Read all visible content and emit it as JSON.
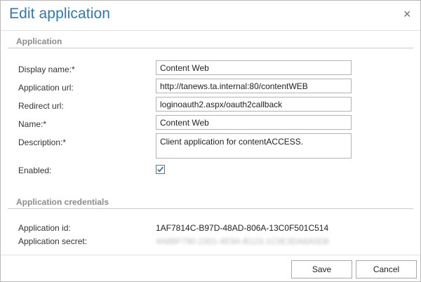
{
  "dialog": {
    "title": "Edit application",
    "close_glyph": "×"
  },
  "application": {
    "header": "Application",
    "fields": {
      "display_name": {
        "label": "Display name:*",
        "value": "Content Web"
      },
      "application_url": {
        "label": "Application url:",
        "value": "http://tanews.ta.internal:80/contentWEB"
      },
      "redirect_url": {
        "label": "Redirect url:",
        "value": "loginoauth2.aspx/oauth2callback"
      },
      "name": {
        "label": "Name:*",
        "value": "Content Web"
      },
      "description": {
        "label": "Description:*",
        "value": "Client application for contentACCESS."
      },
      "enabled": {
        "label": "Enabled:",
        "checked": true
      }
    }
  },
  "credentials": {
    "header": "Application credentials",
    "application_id": {
      "label": "Application id:",
      "value": "1AF7814C-B97D-48AD-806A-13C0F501C514"
    },
    "application_secret": {
      "label": "Application secret:",
      "value": "4A8BF790-2301-4E9A-B123-1C0E3DA6A0D8"
    }
  },
  "buttons": {
    "save": "Save",
    "cancel": "Cancel"
  },
  "colors": {
    "title": "#2a78bd",
    "section_header": "#8c8c8c",
    "checkmark": "#2a78bd"
  },
  "icons": {
    "close": "close-icon",
    "check": "checkmark-icon"
  }
}
